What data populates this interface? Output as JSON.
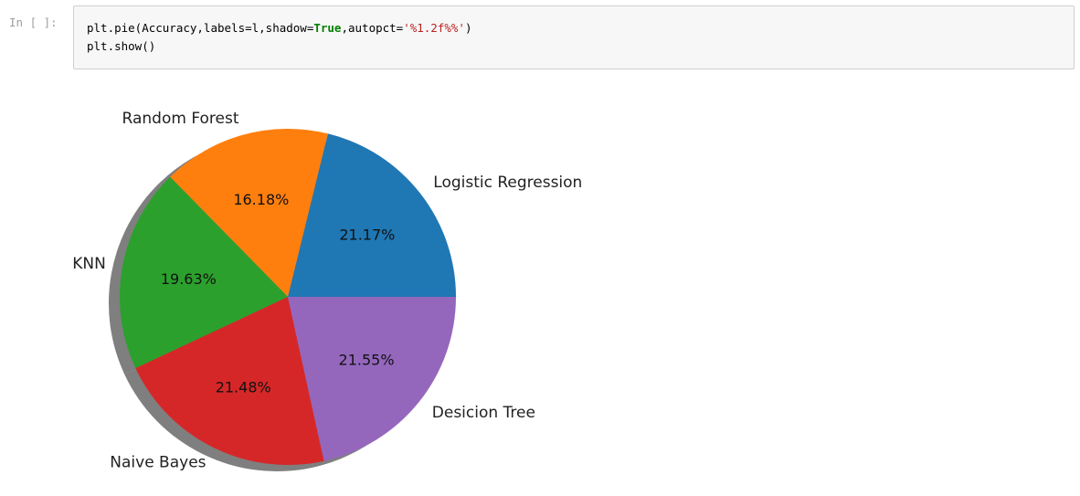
{
  "cell": {
    "prompt": "In [ ]:",
    "code_line_1": {
      "prefix": "plt.pie(Accuracy,labels=l,shadow=",
      "keyword": "True",
      "middle": ",autopct=",
      "string": "'%1.2f%%'",
      "suffix": ")"
    },
    "code_line_2": "plt.show()"
  },
  "chart_data": {
    "type": "pie",
    "shadow": true,
    "start_angle_deg": 0,
    "direction": "counterclockwise",
    "autopct": "%1.2f%%",
    "slices": [
      {
        "label": "Logistic Regression",
        "value": 21.17,
        "pct_label": "21.17%",
        "color": "#1f77b4"
      },
      {
        "label": "Random Forest",
        "value": 16.18,
        "pct_label": "16.18%",
        "color": "#ff7f0e"
      },
      {
        "label": "KNN",
        "value": 19.63,
        "pct_label": "19.63%",
        "color": "#2ca02c"
      },
      {
        "label": "Naive Bayes",
        "value": 21.48,
        "pct_label": "21.48%",
        "color": "#d62728"
      },
      {
        "label": "Desicion Tree",
        "value": 21.55,
        "pct_label": "21.55%",
        "color": "#9467bd"
      }
    ]
  }
}
